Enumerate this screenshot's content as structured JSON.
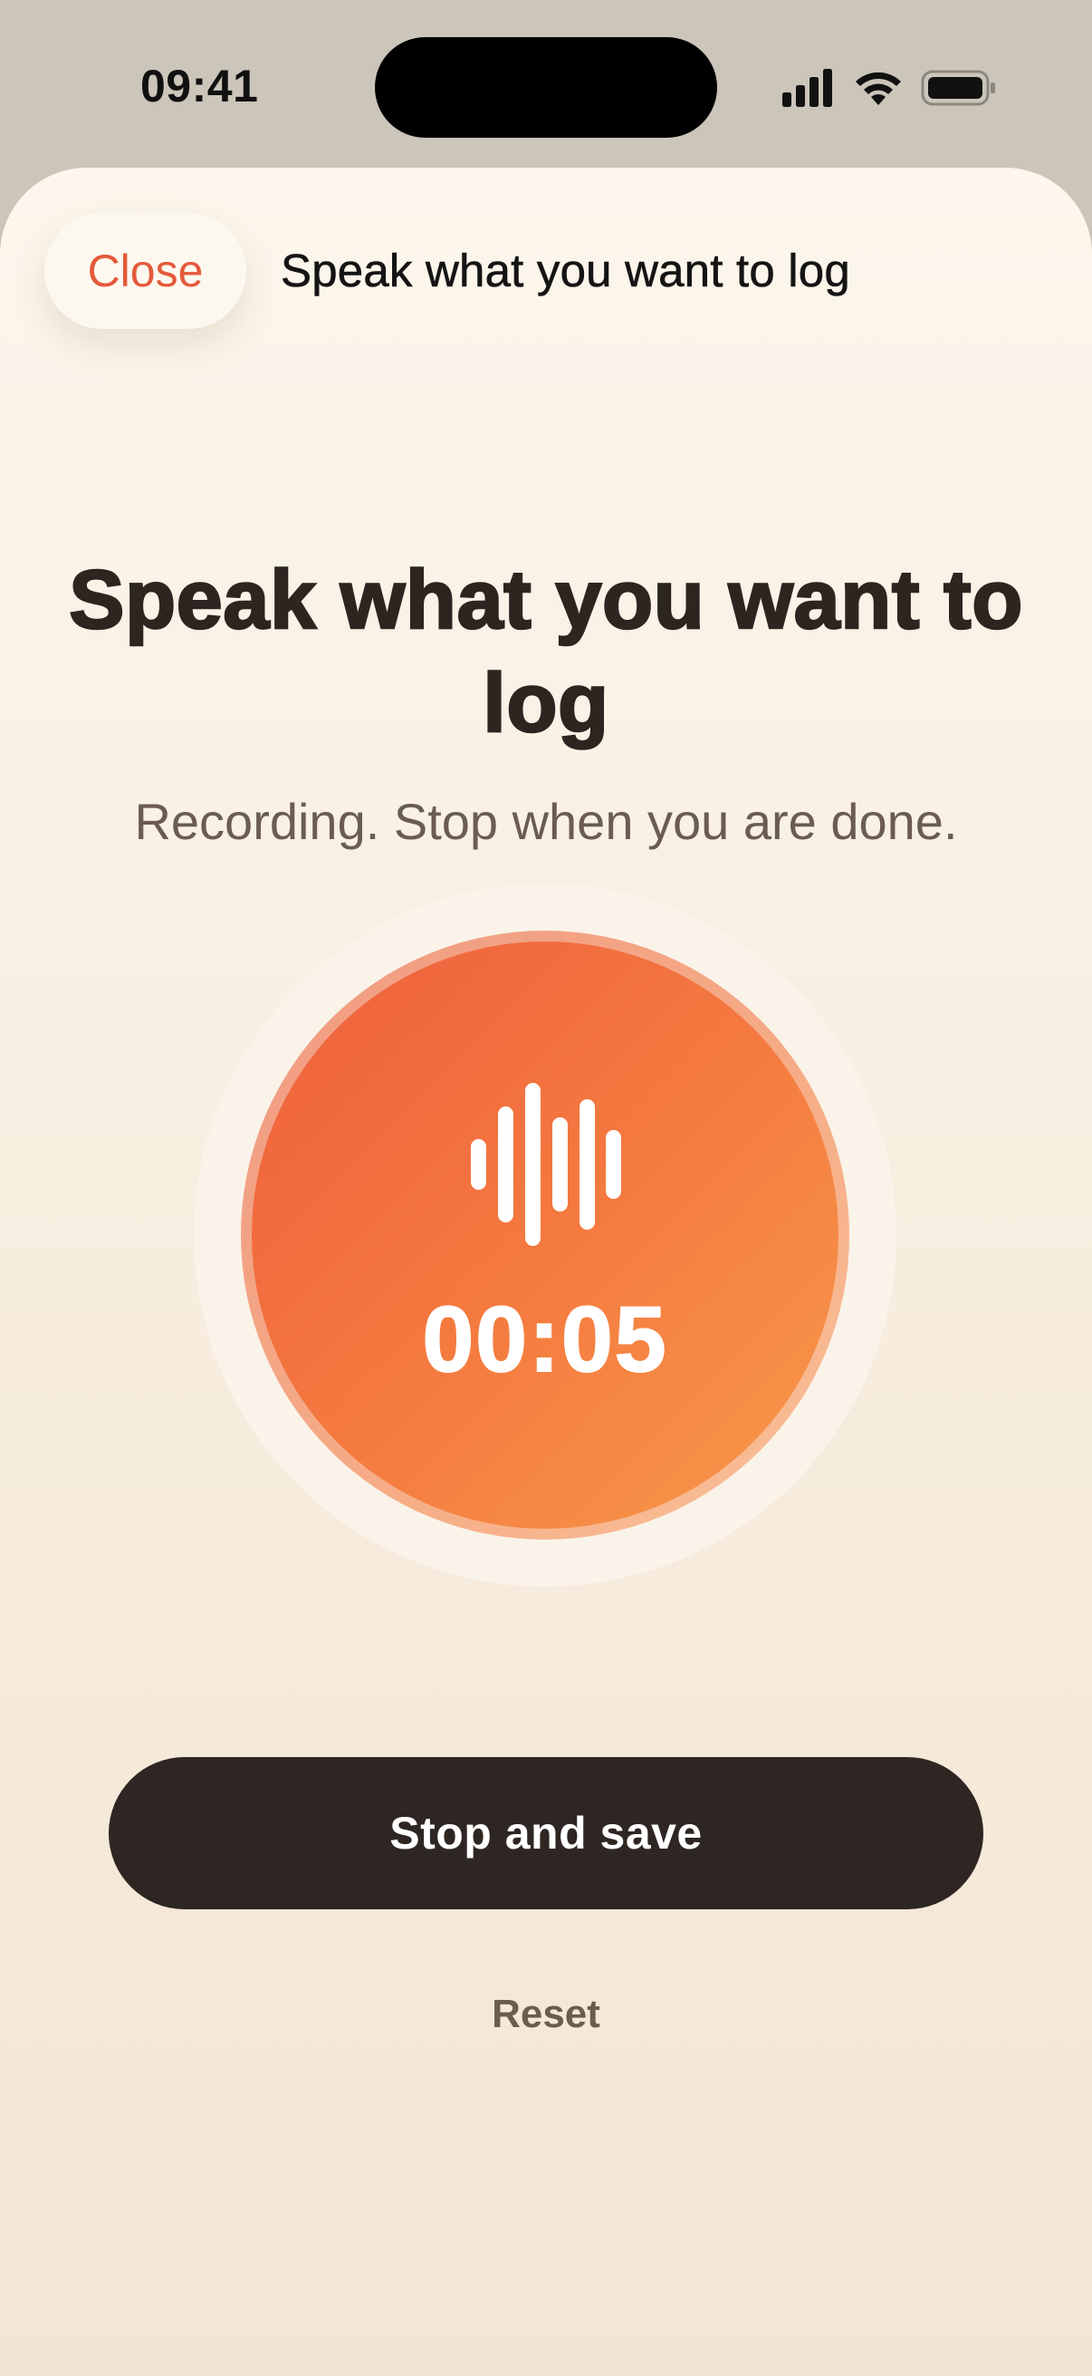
{
  "status_bar": {
    "time": "09:41",
    "icons": [
      "cellular-signal-icon",
      "wifi-icon",
      "battery-icon"
    ]
  },
  "nav": {
    "close_label": "Close",
    "title": "Speak what you want to log"
  },
  "main": {
    "heading": "Speak what you want to log",
    "subheading": "Recording. Stop when you are done.",
    "timer": "00:05",
    "record_icon": "audio-waveform-icon"
  },
  "actions": {
    "stop_label": "Stop and save",
    "reset_label": "Reset"
  },
  "colors": {
    "accent": "#e35a3b",
    "record_gradient_start": "#ef5f3e",
    "record_gradient_end": "#f89a4a",
    "primary_button": "#2e2622",
    "text_primary": "#2d2520",
    "text_secondary": "#6b5c50",
    "background": "#fcf6ec"
  }
}
